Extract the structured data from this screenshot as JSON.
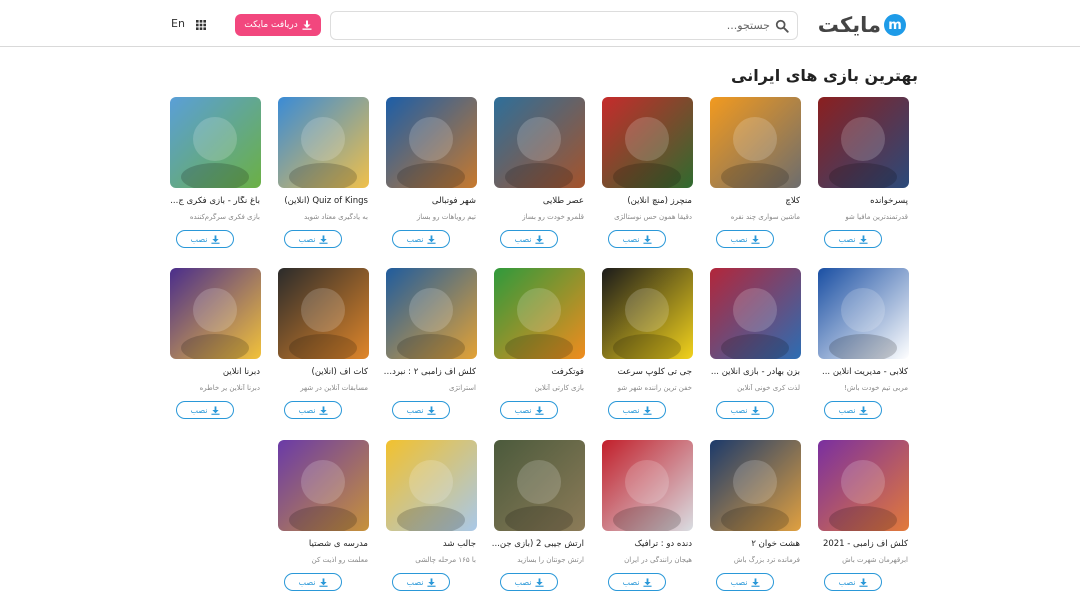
{
  "header": {
    "logo_text": "مایکت",
    "logo_mark": "m",
    "search_placeholder": "جستجو...",
    "get_button": "دریافت مایکت",
    "lang": "En"
  },
  "section": {
    "title": "بهترین بازی های ایرانی",
    "install_label": "نصب"
  },
  "apps": [
    {
      "title": "پسرخوانده",
      "subtitle": "قدرتمندترین مافیا شو",
      "colors": [
        "#8b1f1f",
        "#2a4a7a"
      ]
    },
    {
      "title": "کلاچ",
      "subtitle": "ماشین سواری چند نفره",
      "colors": [
        "#f29a1f",
        "#6d6d6d"
      ]
    },
    {
      "title": "منچرز (منچ آنلاین)",
      "subtitle": "دقیقا همون حس نوستالژی",
      "colors": [
        "#c62b2b",
        "#2f6b2f"
      ]
    },
    {
      "title": "عصر طلایی",
      "subtitle": "قلمرو خودت رو بساز",
      "colors": [
        "#2e6f9a",
        "#a5532b"
      ]
    },
    {
      "title": "شهر فوتبالی",
      "subtitle": "تیم رویاهات رو بساز",
      "colors": [
        "#1c5ea8",
        "#c7792d"
      ]
    },
    {
      "title": "Quiz of Kings (آنلاین)",
      "subtitle": "به یادگیری معتاد شوید",
      "colors": [
        "#3a8bd6",
        "#f0c04a"
      ]
    },
    {
      "title": "باغ نگار - بازی فکری ج...",
      "subtitle": "بازی فکری سرگرم‌کننده",
      "colors": [
        "#5a9fd8",
        "#6bb044"
      ]
    },
    {
      "title": "کلابی - مدیریت آنلاین ...",
      "subtitle": "مربی تیم خودت باش!",
      "colors": [
        "#1a4fa3",
        "#ffffff"
      ]
    },
    {
      "title": "بزن بهادر - بازی آنلاین ...",
      "subtitle": "لذت کری خونی آنلاین",
      "colors": [
        "#b3263a",
        "#2c6db3"
      ]
    },
    {
      "title": "جی تی کلوپ سرعت",
      "subtitle": "خفن ترین راننده شهر شو",
      "colors": [
        "#1b1b1b",
        "#f2d21c"
      ]
    },
    {
      "title": "فوتکرفت",
      "subtitle": "بازی کارتی آنلاین",
      "colors": [
        "#2f9a3c",
        "#f08c1e"
      ]
    },
    {
      "title": "کلش اف زامبی ۲ : نبرد ...",
      "subtitle": "استراتژی",
      "colors": [
        "#1f5c9e",
        "#e3a235"
      ]
    },
    {
      "title": "کات آف (آنلاین)",
      "subtitle": "مسابقات آنلاین در شهر",
      "colors": [
        "#2b2b2b",
        "#e0862a"
      ]
    },
    {
      "title": "دبرنا آنلاین",
      "subtitle": "دبرنا آنلاین یر خاطره",
      "colors": [
        "#4a2d8c",
        "#f2c23a"
      ]
    },
    {
      "title": "کلش آف زامبی - 2021",
      "subtitle": "ابرقهرمان شهرت باش",
      "colors": [
        "#7a2fa0",
        "#e27a3a"
      ]
    },
    {
      "title": "هشت خوان ۲",
      "subtitle": "فرمانده ترد بزرگ باش",
      "colors": [
        "#1c3a6b",
        "#e0a040"
      ]
    },
    {
      "title": "دنده دو : ترافیک",
      "subtitle": "هیجان رانندگی در ایران",
      "colors": [
        "#c21f2b",
        "#d9dde2"
      ]
    },
    {
      "title": "ارتش جیبی 2 (بازی جن...",
      "subtitle": "ارتش جونتان را بسازید",
      "colors": [
        "#4b5a3c",
        "#8c7b58"
      ]
    },
    {
      "title": "جالب شد",
      "subtitle": "با ۱۶۵ مرحله چالشی",
      "colors": [
        "#f2c12e",
        "#a9c8e8"
      ]
    },
    {
      "title": "مدرسه ی شصتیا",
      "subtitle": "معلمت رو اذیت کن",
      "colors": [
        "#6a3aa8",
        "#c7923a"
      ]
    }
  ],
  "colors": {
    "accent": "#2a98d8",
    "brand_pink": "#f2477e",
    "logo_blue": "#1e9be8"
  }
}
